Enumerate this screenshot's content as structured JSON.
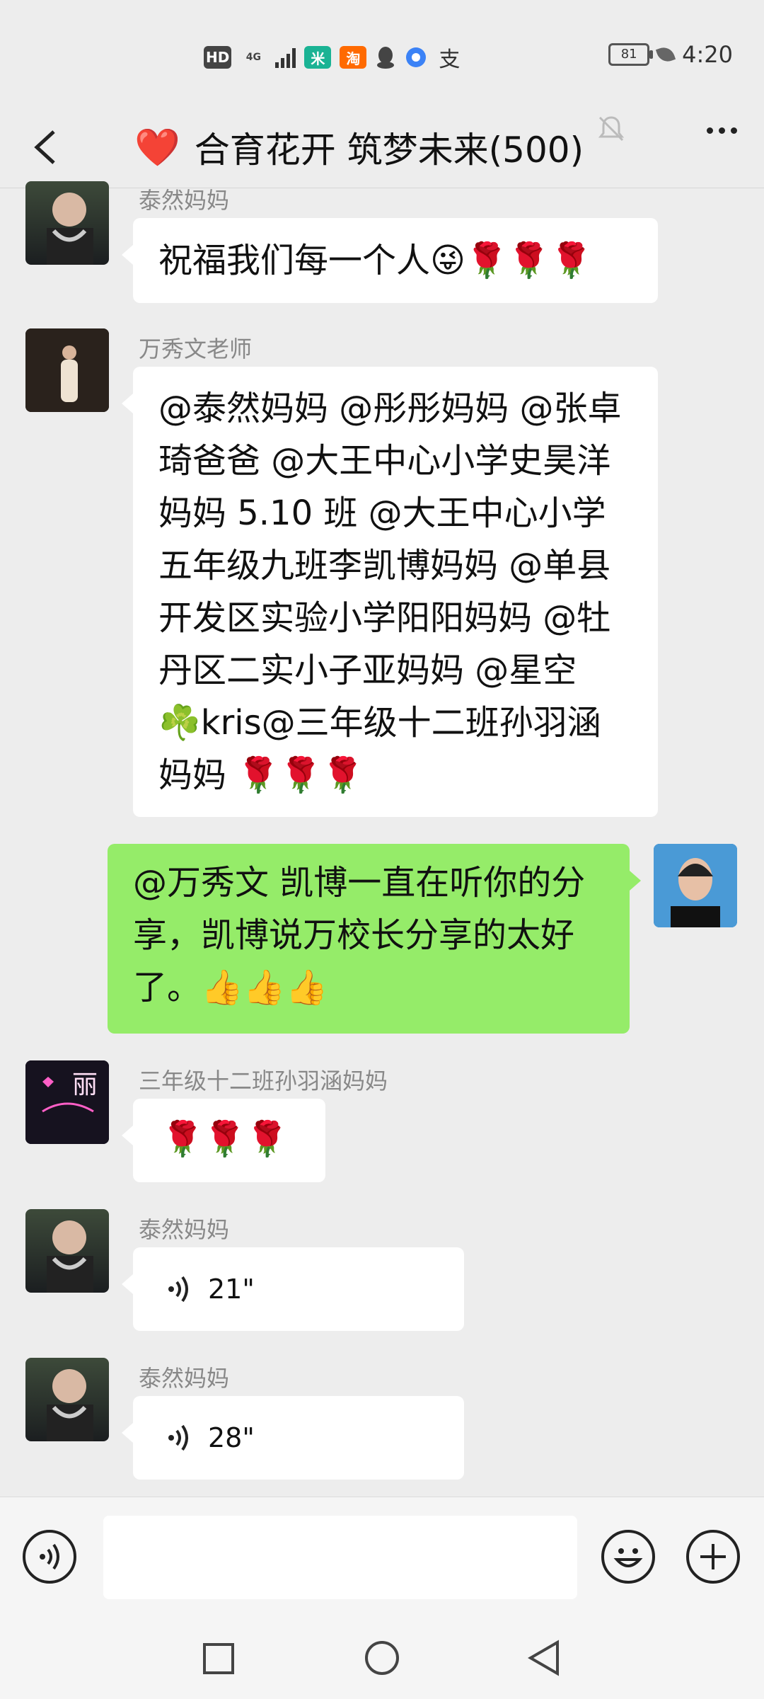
{
  "status_bar": {
    "hd": "HD",
    "network": "4G",
    "battery": "81",
    "time": "4:20",
    "app_chips": [
      {
        "label": "米",
        "color": "#1ab394"
      },
      {
        "label": "淘",
        "color": "#ff6a00"
      },
      {
        "label": "支",
        "color": "#333333"
      }
    ]
  },
  "header": {
    "heart": "❤️",
    "title": "合育花开 筑梦未来(500)"
  },
  "messages": [
    {
      "sender": "泰然妈妈",
      "text": "祝福我们每一个人😜🌹🌹🌹"
    },
    {
      "sender": "万秀文老师",
      "lines": [
        "@泰然妈妈 @彤彤妈妈 @张卓",
        "琦爸爸 @大王中心小学史昊洋",
        "妈妈 5.10 班 @大王中心小学",
        "五年级九班李凯博妈妈 @单县",
        "开发区实验小学阳阳妈妈 @牡",
        "丹区二实小子亚妈妈 @星空",
        "☘️kris@三年级十二班孙羽涵",
        "妈妈 🌹🌹🌹"
      ]
    },
    {
      "self": true,
      "lines": [
        "@万秀文 凯博一直在听你的分",
        "享，凯博说万校长分享的太好",
        "了。👍👍👍"
      ]
    },
    {
      "sender": "三年级十二班孙羽涵妈妈",
      "text": "🌹🌹🌹",
      "avatar_text": "丽"
    },
    {
      "sender": "泰然妈妈",
      "voice": "21\""
    },
    {
      "sender": "泰然妈妈",
      "voice": "28\""
    }
  ],
  "colors": {
    "background": "#ededed",
    "self_bubble": "#95ec69",
    "other_bubble": "#ffffff"
  }
}
